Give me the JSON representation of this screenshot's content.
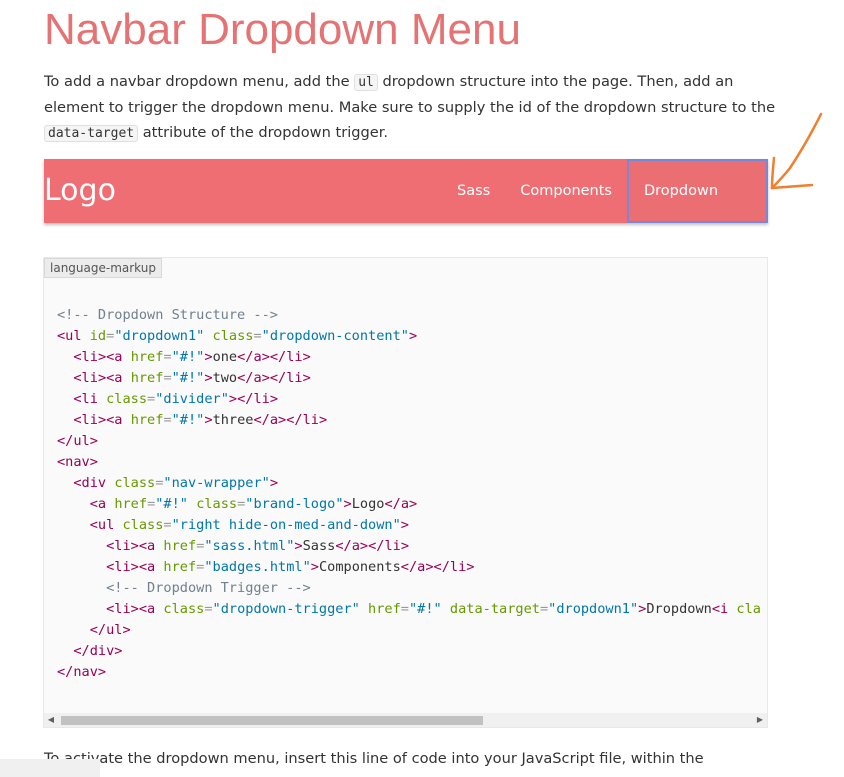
{
  "page_title": "Navbar Dropdown Menu",
  "intro": {
    "part1": "To add a navbar dropdown menu, add the ",
    "code1": "ul",
    "part2": " dropdown structure into the page. Then, add an element to trigger the dropdown menu. Make sure to supply the id of the dropdown structure to the ",
    "code2": "data-target",
    "part3": " attribute of the dropdown trigger."
  },
  "demo_nav": {
    "logo": "Logo",
    "links": [
      "Sass",
      "Components"
    ],
    "dropdown_label": "Dropdown",
    "caret_icon": "arrow-drop-down-icon",
    "bg_color": "#ee6e73"
  },
  "annotation": {
    "icon": "hand-drawn-arrow-icon",
    "color": "#f07f2e"
  },
  "code_block": {
    "language_label": "language-markup",
    "lines": [
      "<!-- Dropdown Structure -->",
      "<ul id=\"dropdown1\" class=\"dropdown-content\">",
      "  <li><a href=\"#!\">one</a></li>",
      "  <li><a href=\"#!\">two</a></li>",
      "  <li class=\"divider\"></li>",
      "  <li><a href=\"#!\">three</a></li>",
      "</ul>",
      "<nav>",
      "  <div class=\"nav-wrapper\">",
      "    <a href=\"#!\" class=\"brand-logo\">Logo</a>",
      "    <ul class=\"right hide-on-med-and-down\">",
      "      <li><a href=\"sass.html\">Sass</a></li>",
      "      <li><a href=\"badges.html\">Components</a></li>",
      "      <!-- Dropdown Trigger -->",
      "      <li><a class=\"dropdown-trigger\" href=\"#!\" data-target=\"dropdown1\">Dropdown<i cla",
      "    </ul>",
      "  </div>",
      "</nav>"
    ],
    "scroll_left_icon": "scroll-left-arrow-icon",
    "scroll_right_icon": "scroll-right-arrow-icon"
  },
  "outro": "To activate the dropdown menu, insert this line of code into your JavaScript file, within the"
}
